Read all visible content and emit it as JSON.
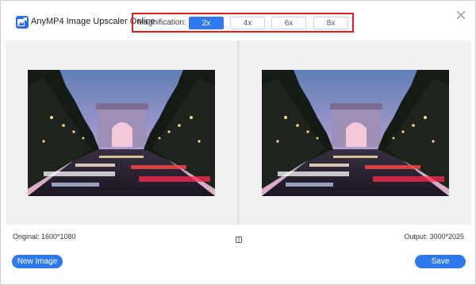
{
  "header": {
    "app_title": "AnyMP4 Image Upscaler Online",
    "magnification_label": "Magnification:",
    "options": [
      {
        "label": "2x",
        "selected": true
      },
      {
        "label": "4x",
        "selected": false
      },
      {
        "label": "6x",
        "selected": false
      },
      {
        "label": "8x",
        "selected": false
      }
    ]
  },
  "footer": {
    "original": "Original: 1600*1080",
    "output": "Output: 3000*2025",
    "new_image_label": "New Image",
    "save_label": "Save"
  },
  "colors": {
    "accent": "#2f79f0",
    "highlight_border": "#e01f1f",
    "pane_background": "#f1f1f1"
  },
  "icons": {
    "logo": "image-upscale-logo-icon",
    "close": "close-icon",
    "compare": "compare-icon"
  }
}
